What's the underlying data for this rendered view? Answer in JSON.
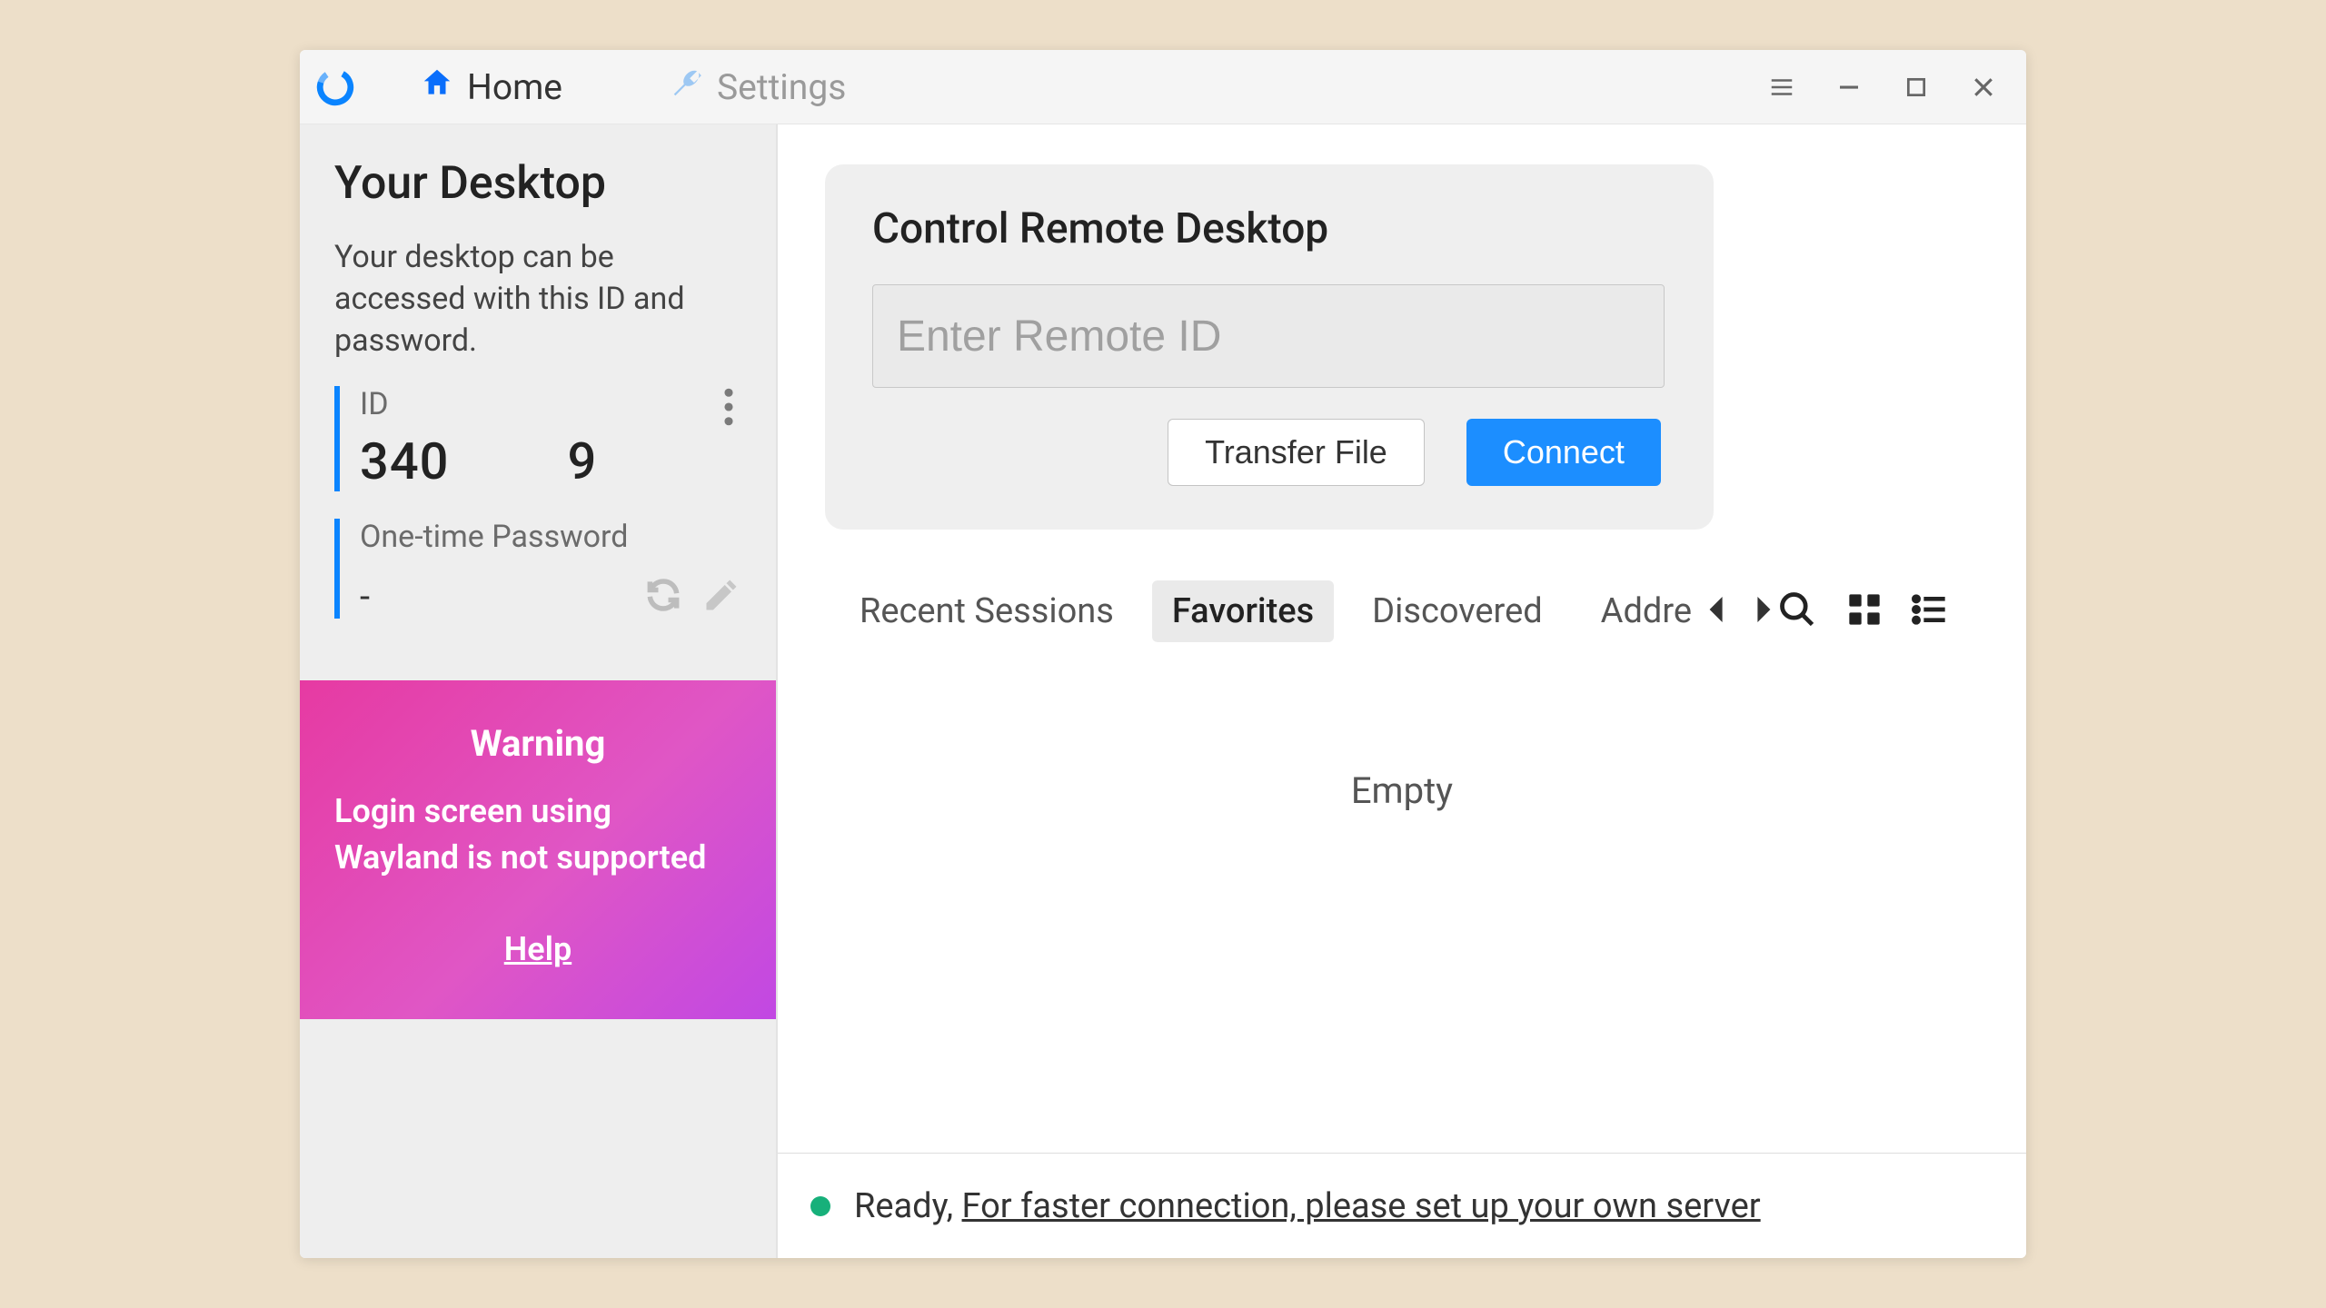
{
  "titlebar": {
    "tabs": {
      "home": "Home",
      "settings": "Settings"
    }
  },
  "sidebar": {
    "title": "Your Desktop",
    "desc": "Your desktop can be accessed with this ID and password.",
    "id_label": "ID",
    "id_left": "340",
    "id_right": "9",
    "pwd_label": "One-time Password",
    "pwd_value": "-"
  },
  "warning": {
    "title": "Warning",
    "body": "Login screen using Wayland is not supported",
    "help": "Help"
  },
  "main": {
    "panel_title": "Control Remote Desktop",
    "remote_placeholder": "Enter Remote ID",
    "transfer_label": "Transfer File",
    "connect_label": "Connect",
    "tabs": [
      "Recent Sessions",
      "Favorites",
      "Discovered",
      "Addre"
    ],
    "active_tab": 1,
    "empty": "Empty"
  },
  "status": {
    "ready": "Ready,",
    "link": "For faster connection, please set up your own server"
  }
}
